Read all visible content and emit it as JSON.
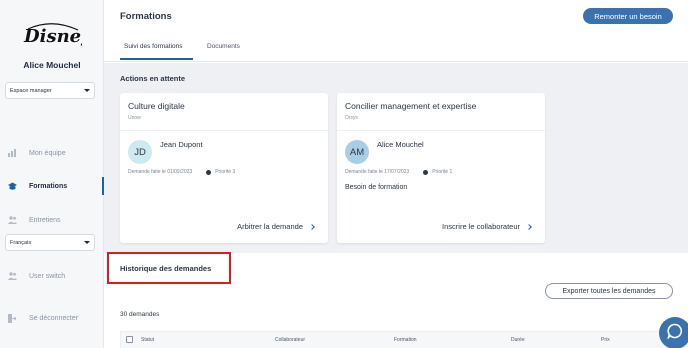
{
  "brand": {
    "logo_text": "Disney"
  },
  "user": {
    "name": "Alice Mouchel"
  },
  "sidebar": {
    "space_select": "Espace manager",
    "language_select": "Français",
    "items": [
      {
        "label": "Mon équipe",
        "icon": "chart-icon"
      },
      {
        "label": "Formations",
        "icon": "graduation-cap-icon",
        "active": true
      },
      {
        "label": "Entretiens",
        "icon": "people-icon"
      },
      {
        "label": "User switch",
        "icon": "user-switch-icon"
      },
      {
        "label": "Se déconnecter",
        "icon": "logout-icon"
      }
    ]
  },
  "header": {
    "title": "Formations",
    "primary_button": "Remonter un besoin",
    "tabs": [
      {
        "label": "Suivi des formations",
        "active": true
      },
      {
        "label": "Documents",
        "active": false
      }
    ]
  },
  "pending": {
    "title": "Actions en attente",
    "cards": [
      {
        "title": "Culture digitale",
        "provider": "Unow",
        "initials": "JD",
        "avatar_color": "#cdeaf0",
        "person": "Jean Dupont",
        "date": "Demande faite le 01/09/2023",
        "priority": "Priorité 3",
        "need": "",
        "action": "Arbitrer la demande"
      },
      {
        "title": "Concilier management et expertise",
        "provider": "Orsys",
        "initials": "AM",
        "avatar_color": "#a9cde4",
        "person": "Alice Mouchel",
        "date": "Demande faite le 17/07/2023",
        "priority": "Priorité 1",
        "need": "Besoin de formation",
        "action": "Inscrire le collaborateur"
      }
    ]
  },
  "history": {
    "title": "Historique des demandes",
    "export_button": "Exporter toutes les demandes",
    "count": "30 demandes",
    "columns": [
      "Statut",
      "Collaborateur",
      "Formation",
      "Durée",
      "Prix"
    ]
  },
  "colors": {
    "accent": "#3a72b0",
    "highlight": "#d81e1e"
  }
}
